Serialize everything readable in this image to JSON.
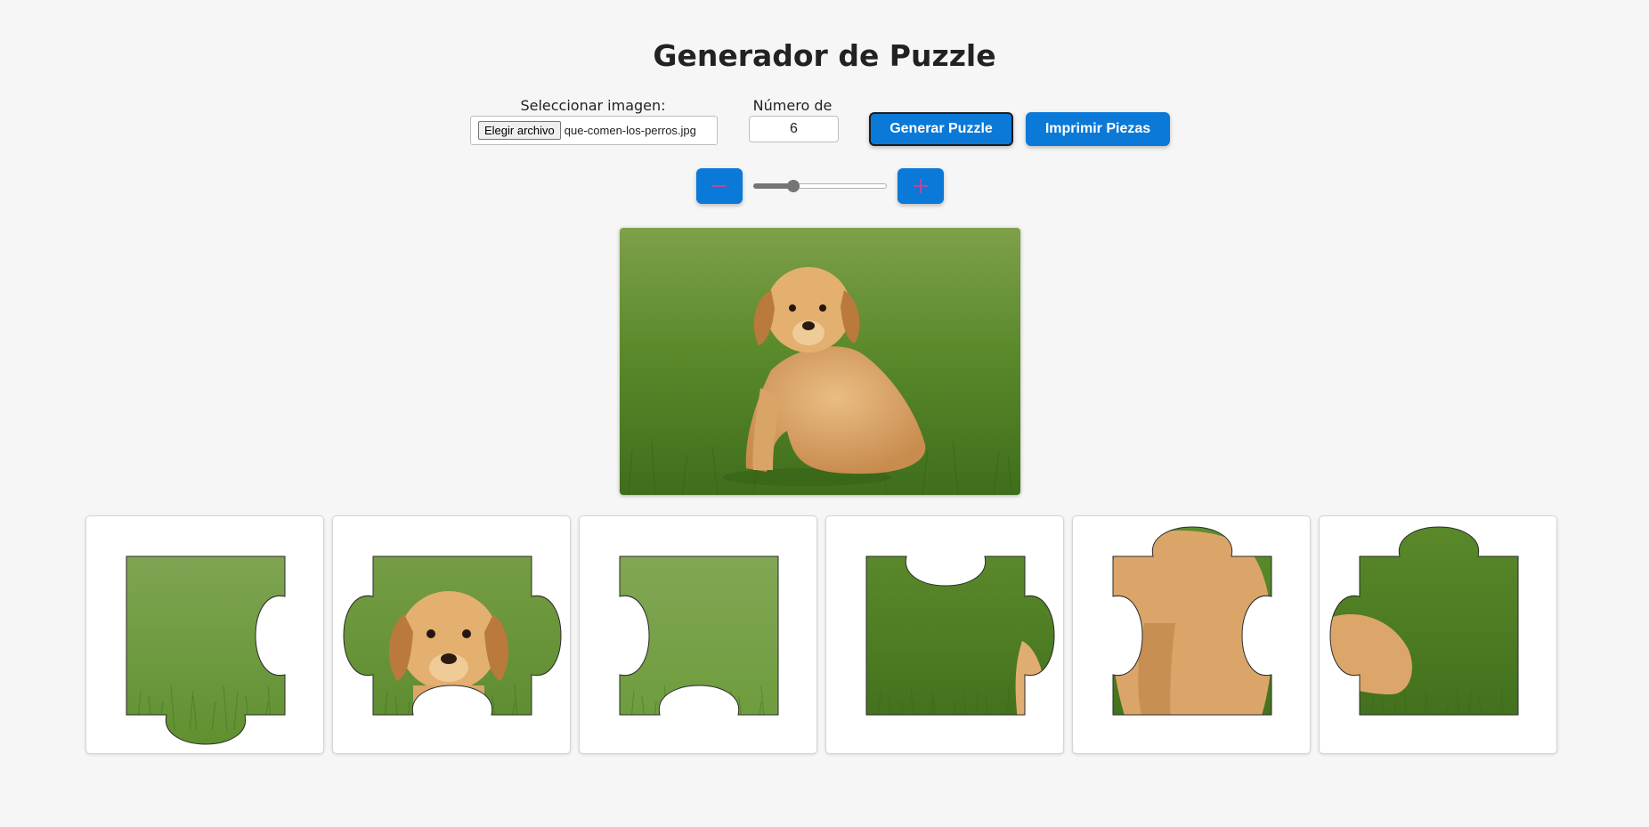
{
  "title": "Generador de Puzzle",
  "controls": {
    "image_label": "Seleccionar imagen:",
    "file_button": "Elegir archivo",
    "file_name": "que-comen-los-perros.jpg",
    "pieces_label": "Número de piezas:",
    "pieces_value": "6",
    "generate_button": "Generar Puzzle",
    "print_button": "Imprimir Piezas"
  },
  "zoom": {
    "minus_icon": "minus-icon",
    "plus_icon": "plus-icon",
    "minus_glyph": "−",
    "plus_glyph": "+",
    "level": 0.28
  },
  "colors": {
    "accent": "#0a79d8",
    "icon": "#b04aa6",
    "background": "#f6f6f6"
  },
  "preview": {
    "subject": "golden retriever puppy sitting on grass"
  },
  "pieces": [
    {
      "top": "flat",
      "right": "in",
      "bottom": "out",
      "left": "flat"
    },
    {
      "top": "flat",
      "right": "out",
      "bottom": "in",
      "left": "out"
    },
    {
      "top": "flat",
      "right": "flat",
      "bottom": "in",
      "left": "in"
    },
    {
      "top": "in",
      "right": "out",
      "bottom": "flat",
      "left": "flat"
    },
    {
      "top": "out",
      "right": "in",
      "bottom": "flat",
      "left": "in"
    },
    {
      "top": "out",
      "right": "flat",
      "bottom": "flat",
      "left": "out"
    }
  ]
}
